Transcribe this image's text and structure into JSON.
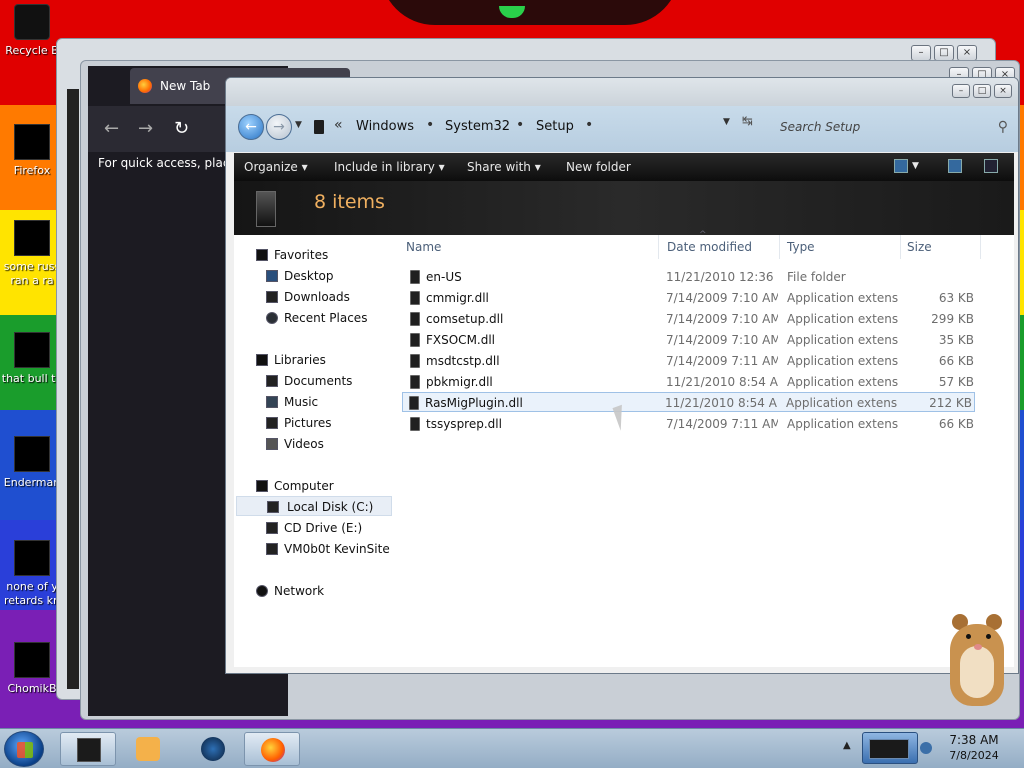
{
  "desktop": {
    "icons": [
      {
        "label": "Recycle B"
      },
      {
        "label": "Firefox"
      },
      {
        "label": "some russ",
        "label2": "ran a ra"
      },
      {
        "label": "that bull te"
      },
      {
        "label": "Enderman"
      },
      {
        "label": "none of y",
        "label2": "retards kn"
      },
      {
        "label": "ChomikB"
      }
    ]
  },
  "browser": {
    "tab_title": "New Tab",
    "quick_access_text": "For quick access, place y"
  },
  "explorer": {
    "address": {
      "crumbs": [
        "Windows",
        "System32",
        "Setup"
      ],
      "search_placeholder": "Search Setup"
    },
    "toolbar": {
      "organize": "Organize",
      "include_in_library": "Include in library",
      "share_with": "Share with",
      "new_folder": "New folder"
    },
    "header": {
      "item_count": "8 items"
    },
    "nav_pane": {
      "favorites": "Favorites",
      "desktop": "Desktop",
      "downloads": "Downloads",
      "recent_places": "Recent Places",
      "libraries": "Libraries",
      "documents": "Documents",
      "music": "Music",
      "pictures": "Pictures",
      "videos": "Videos",
      "computer": "Computer",
      "local_disk": "Local Disk (C:)",
      "cd_drive": "CD Drive (E:)",
      "network_share": "VM0b0t KevinSite",
      "network": "Network"
    },
    "columns": {
      "name": "Name",
      "date_modified": "Date modified",
      "type": "Type",
      "size": "Size"
    },
    "files": [
      {
        "name": "en-US",
        "date": "11/21/2010 12:36 ...",
        "type": "File folder",
        "size": ""
      },
      {
        "name": "cmmigr.dll",
        "date": "7/14/2009 7:10 AM",
        "type": "Application extens...",
        "size": "63 KB"
      },
      {
        "name": "comsetup.dll",
        "date": "7/14/2009 7:10 AM",
        "type": "Application extens...",
        "size": "299 KB"
      },
      {
        "name": "FXSOCM.dll",
        "date": "7/14/2009 7:10 AM",
        "type": "Application extens...",
        "size": "35 KB"
      },
      {
        "name": "msdtcstp.dll",
        "date": "7/14/2009 7:11 AM",
        "type": "Application extens...",
        "size": "66 KB"
      },
      {
        "name": "pbkmigr.dll",
        "date": "11/21/2010 8:54 AM",
        "type": "Application extens...",
        "size": "57 KB"
      },
      {
        "name": "RasMigPlugin.dll",
        "date": "11/21/2010 8:54 AM",
        "type": "Application extens...",
        "size": "212 KB"
      },
      {
        "name": "tssysprep.dll",
        "date": "7/14/2009 7:11 AM",
        "type": "Application extens...",
        "size": "66 KB"
      }
    ]
  },
  "taskbar": {
    "time": "7:38 AM",
    "date": "7/8/2024"
  },
  "colors": {
    "explorer_header_count": "#f0b060",
    "selection_border": "#9fc1e6",
    "taskbar": "#a9bfd4"
  },
  "icons": {
    "start": "windows-start-icon",
    "back": "back-arrow-icon",
    "forward": "forward-arrow-icon",
    "search": "search-icon",
    "refresh": "refresh-icon",
    "folder": "folder-icon",
    "dll": "dll-file-icon"
  }
}
